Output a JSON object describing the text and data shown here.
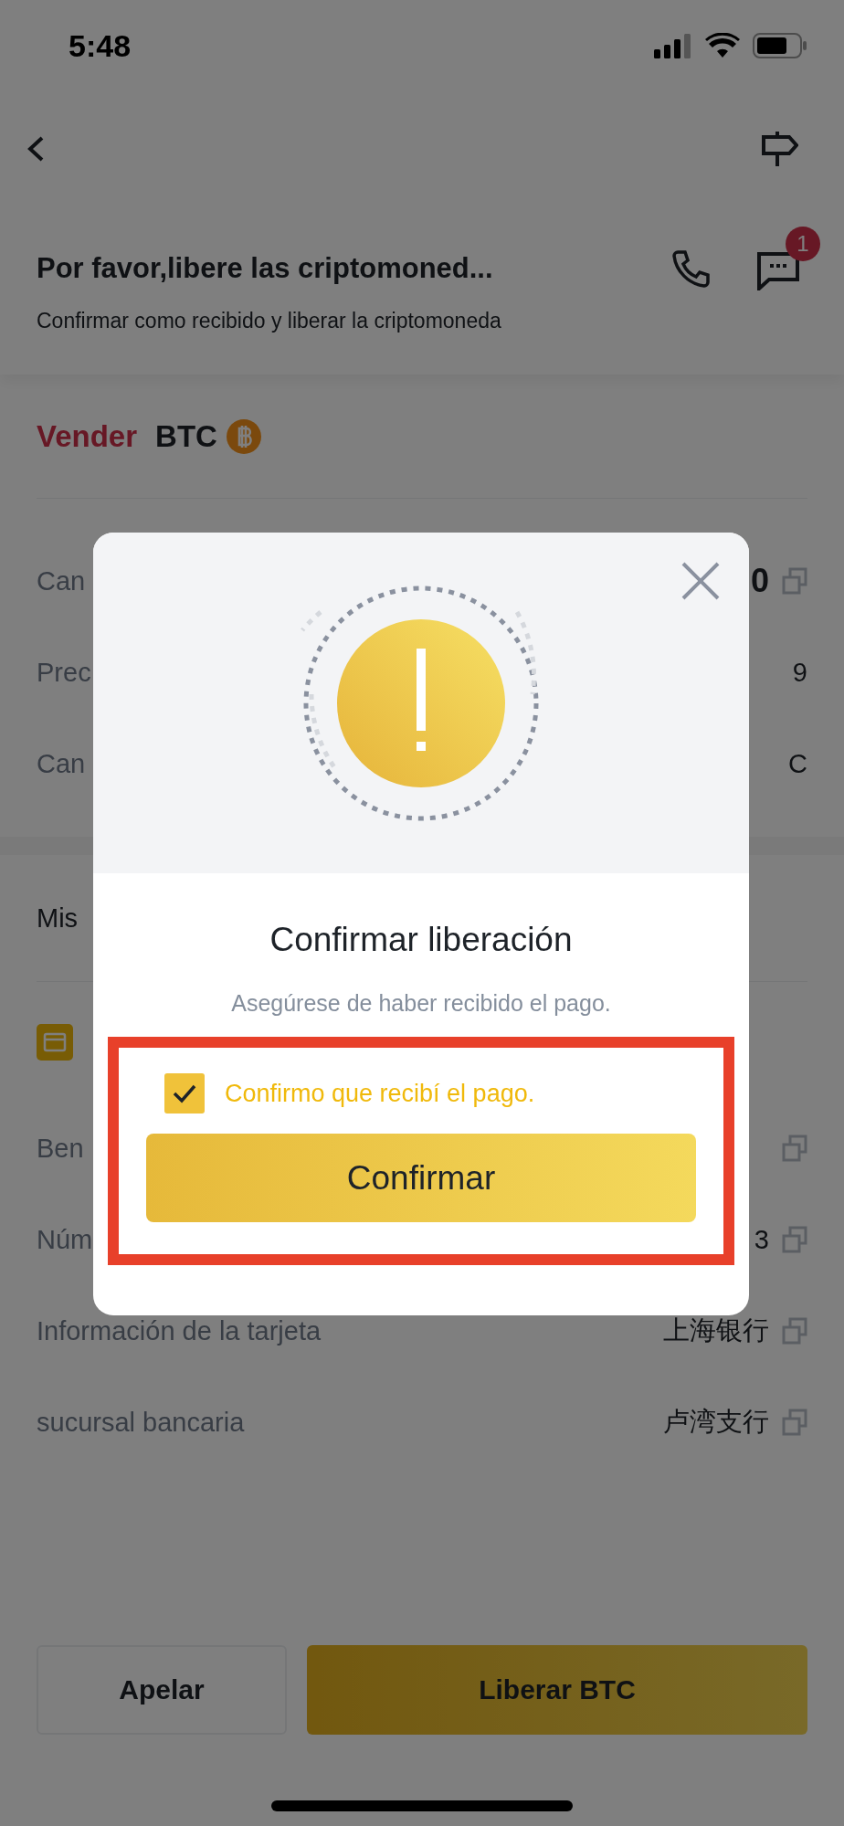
{
  "status_bar": {
    "time": "5:48"
  },
  "header": {
    "title": "Por favor,libere las criptomoned...",
    "subtitle": "Confirmar como recibido y liberar la criptomoneda",
    "chat_badge": "1"
  },
  "order": {
    "side": "Vender",
    "asset": "BTC",
    "rows": [
      {
        "label": "Can",
        "value": "0",
        "copyable": true,
        "emphasis": true
      },
      {
        "label": "Prec",
        "value": "9",
        "copyable": false,
        "emphasis": false
      },
      {
        "label": "Can",
        "value": "C",
        "copyable": false,
        "emphasis": false
      }
    ]
  },
  "payment": {
    "label": "Mis",
    "rows": [
      {
        "label": "Ben",
        "copyable": true
      },
      {
        "label": "Núm",
        "value": "3",
        "copyable": true
      },
      {
        "label": "Información de la tarjeta",
        "value": "上海银行",
        "copyable": true
      },
      {
        "label": "sucursal bancaria",
        "value": "卢湾支行",
        "copyable": true
      }
    ]
  },
  "actions": [
    {
      "label": "Apelar",
      "kind": "outline"
    },
    {
      "label": "Liberar BTC",
      "kind": "primary"
    }
  ],
  "dialog": {
    "title": "Confirmar liberación",
    "message": "Asegúrese de haber recibido el pago.",
    "highlighted": true,
    "checkbox": {
      "label": "Confirmo que recibí el pago.",
      "checked": true
    },
    "button": "Confirmar"
  }
}
